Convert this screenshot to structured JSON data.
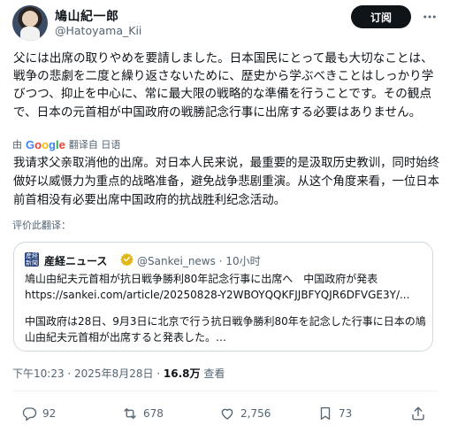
{
  "author": {
    "name": "鳩山紀一郎",
    "handle": "@Hatoyama_Kii",
    "subscribe_label": "订阅"
  },
  "post": {
    "text_ja": "父には出席の取りやめを要請しました。日本国民にとって最も大切なことは、戦争の悲劇を二度と繰り返さないために、歴史から学ぶべきことはしっかり学びつつ、抑止を中心に、常に最大限の戦略的な準備を行うことです。その観点で、日本の元首相が中国政府の戦勝記念行事に出席する必要はありません。",
    "translate_by": "由",
    "translate_google": "Google",
    "translate_from": "翻译自 日语",
    "text_zh": "我请求父亲取消他的出席。对日本人民来说，最重要的是汲取历史教训，同时始终做好以威慑力为重点的战略准备，避免战争悲剧重演。从这个角度来看，一位日本前首相没有必要出席中国政府的抗战胜利纪念活动。",
    "rate_translation": "评价此翻译："
  },
  "quote": {
    "logo_text": "産経新聞",
    "name": "産経ニュース",
    "handle_time": "@Sankei_news · 10小时",
    "text_line1": "鳩山由紀夫元首相が抗日戦争勝利80年記念行事に出席へ　中国政府が発表",
    "url": "https://sankei.com/article/20250828-Y2WBOYQQKFJJBFYQJR6DFVGE3Y/...",
    "text_line2": "中国政府は28日、9月3日に北京で行う抗日戦争勝利80年を記念した行事に日本の鳩山由紀夫元首相が出席すると発表した。…"
  },
  "meta": {
    "time": "下午10:23 · 2025年8月28日 · ",
    "views": "16.8万",
    "views_label": " 查看"
  },
  "actions": {
    "replies": "92",
    "retweets": "678",
    "likes": "2,756",
    "bookmarks": "73"
  },
  "icons": {
    "more": "more-dots-icon",
    "verified": "verified-badge-icon",
    "reply": "reply-icon",
    "retweet": "retweet-icon",
    "like": "heart-icon",
    "bookmark": "bookmark-icon",
    "share": "share-icon"
  },
  "colors": {
    "verified": "#e2b719",
    "muted": "#536471",
    "text": "#0f1419"
  }
}
